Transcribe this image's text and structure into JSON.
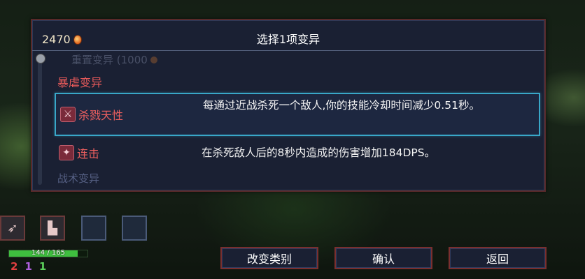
{
  "header": {
    "cells": "2470",
    "cell_icon": "cell-icon",
    "title": "选择1项变异"
  },
  "list": {
    "faded_top_item": "重置变异 (1000",
    "category_top": "暴虐变异",
    "category_bottom": "战术变异",
    "items": [
      {
        "name": "杀戮天性",
        "icon": "killer-instinct-icon",
        "description": "每通过近战杀死一个敌人,你的技能冷却时间减少0.51秒。",
        "selected": true
      },
      {
        "name": "连击",
        "icon": "combo-icon",
        "description": "在杀死敌人后的8秒内造成的伤害增加184DPS。",
        "selected": false
      }
    ]
  },
  "hud": {
    "health_text": "144 / 165",
    "health_current": 144,
    "health_max": 165,
    "scrolls": {
      "brutality": "2",
      "tactics": "1",
      "survival": "1"
    },
    "slots": [
      "weapon-slot-1",
      "weapon-slot-2",
      "skill-slot-1",
      "skill-slot-2"
    ]
  },
  "buttons": {
    "change_category": "改变类别",
    "confirm": "确认",
    "back": "返回"
  },
  "colors": {
    "accent_red": "#ec5f5f",
    "selection_border": "#39a7c8",
    "panel_bg": "#1a2033"
  }
}
